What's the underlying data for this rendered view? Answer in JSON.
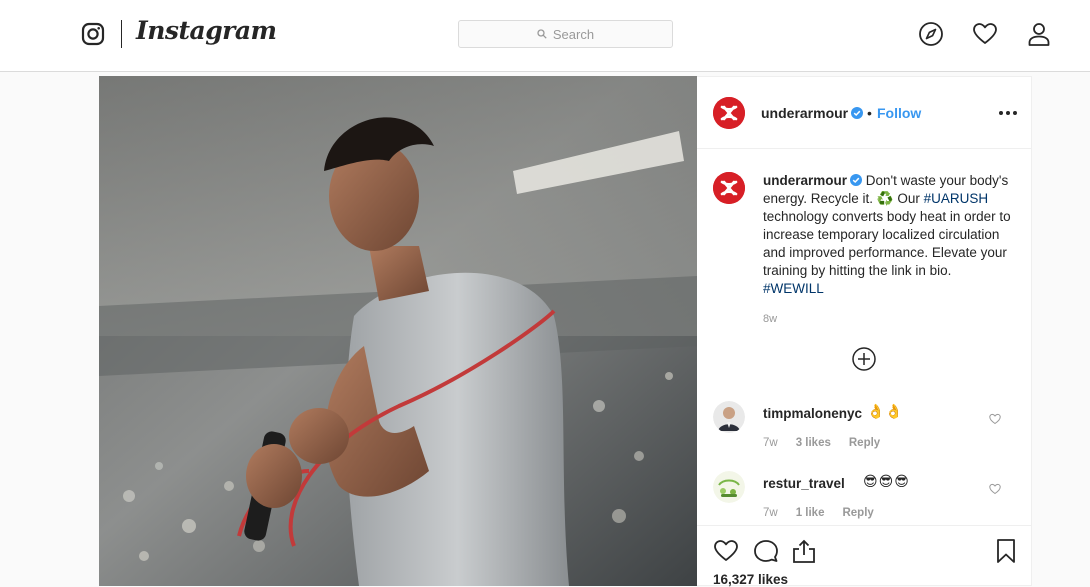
{
  "nav": {
    "brand": "Instagram",
    "search_placeholder": "Search",
    "icons": [
      "instagram-glyph-icon",
      "search-icon",
      "compass-icon",
      "heart-icon",
      "profile-icon"
    ]
  },
  "post": {
    "author": "underarmour",
    "verified": true,
    "dot": "•",
    "follow_label": "Follow",
    "caption": {
      "author": "underarmour",
      "text_1": "Don't waste your body's energy. Recycle it.",
      "emoji": "♻️",
      "text_2": "Our",
      "hashtag_1": "#UARUSH",
      "text_3": "technology converts body heat in order to increase temporary localized circulation and improved performance. Elevate your training by hitting the link in bio.",
      "hashtag_2": "#WEWILL",
      "time": "8w"
    },
    "comments": [
      {
        "user": "timpmalonenyc",
        "emoji": "👌👌",
        "time": "7w",
        "likes": "3 likes",
        "reply": "Reply"
      },
      {
        "user": "restur_travel",
        "emoji": "😎😎😎",
        "time": "7w",
        "likes": "1 like",
        "reply": "Reply"
      }
    ],
    "likes_count": "16,327 likes",
    "colors": {
      "brand_red": "#d71f26",
      "link_blue": "#3897f0",
      "hashtag": "#003569"
    }
  }
}
